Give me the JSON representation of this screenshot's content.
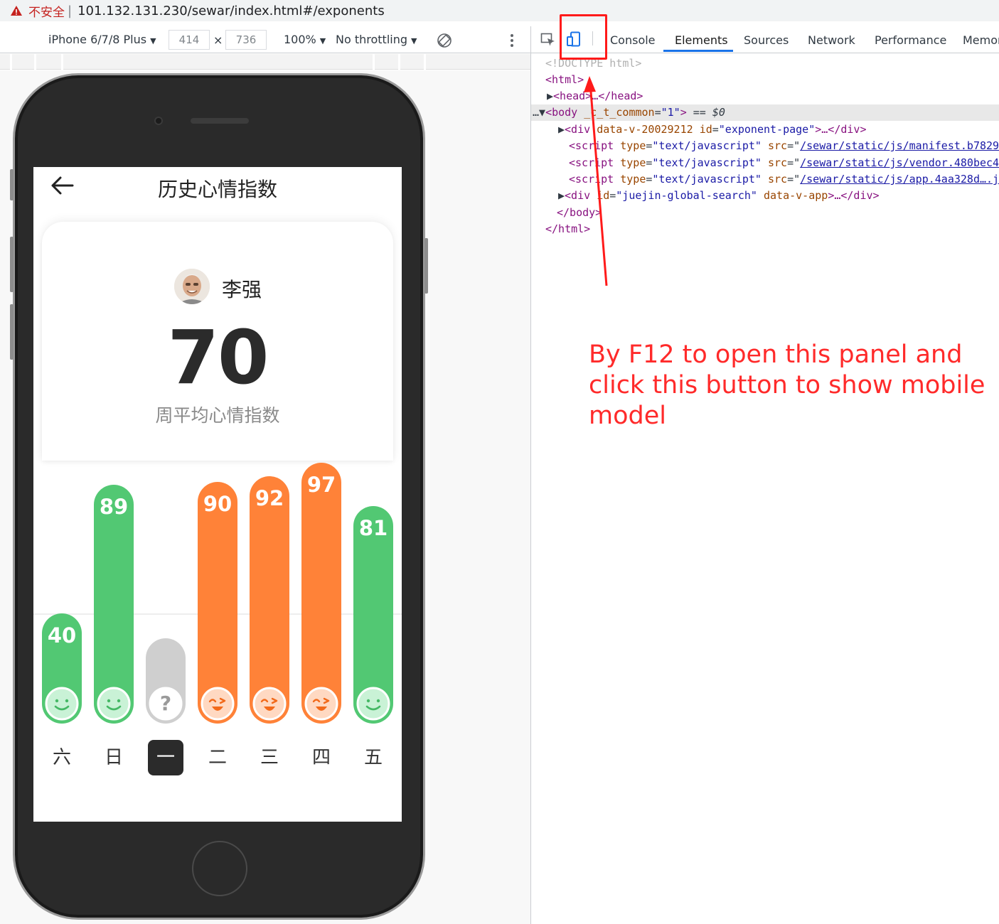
{
  "browser": {
    "insecure_label": "不安全",
    "separator": "|",
    "url": "101.132.131.230/sewar/index.html#/exponents"
  },
  "device_toolbar": {
    "device": "iPhone 6/7/8 Plus",
    "width": "414",
    "times": "×",
    "height": "736",
    "zoom": "100%",
    "throttling": "No throttling"
  },
  "devtools": {
    "tabs": [
      "Console",
      "Elements",
      "Sources",
      "Network",
      "Performance",
      "Memor"
    ],
    "active_tab": "Elements",
    "dom": {
      "doctype": "<!DOCTYPE html>",
      "html_open": "<html>",
      "head": "<head>…</head>",
      "body_tag": "body",
      "body_attr": "_c_t_common",
      "body_val": "\"1\"",
      "body_suffix": "== $0",
      "div1_attr1": "data-v-20029212",
      "div1_attr2": "id",
      "div1_val2": "\"exponent-page\"",
      "script_type_val": "\"text/javascript\"",
      "script1_src": "/sewar/static/js/manifest.b7829",
      "script2_src": "/sewar/static/js/vendor.480bec4",
      "script3_src": "/sewar/static/js/app.4aa328d….j",
      "div2_attr1": "id",
      "div2_val1": "\"juejin-global-search\"",
      "div2_attr2": "data-v-app",
      "body_close": "</body>",
      "html_close": "</html>"
    }
  },
  "annotation": "By F12 to open this panel and click this button to show mobile model",
  "app": {
    "title": "历史心情指数",
    "user_name": "李强",
    "score": "70",
    "score_label": "周平均心情指数",
    "colors": {
      "green": "#52c873",
      "orange": "#ff8238",
      "gray": "#cfcfcf"
    },
    "bars": [
      {
        "day": "六",
        "value": "40",
        "level": 40,
        "mood": "smile",
        "color": "green"
      },
      {
        "day": "日",
        "value": "89",
        "level": 89,
        "mood": "smile",
        "color": "green"
      },
      {
        "day": "一",
        "value": "",
        "level": 0,
        "mood": "unknown",
        "color": "gray"
      },
      {
        "day": "二",
        "value": "90",
        "level": 90,
        "mood": "laugh",
        "color": "orange"
      },
      {
        "day": "三",
        "value": "92",
        "level": 92,
        "mood": "laugh",
        "color": "orange"
      },
      {
        "day": "四",
        "value": "97",
        "level": 97,
        "mood": "laugh",
        "color": "orange"
      },
      {
        "day": "五",
        "value": "81",
        "level": 81,
        "mood": "smile",
        "color": "green"
      }
    ],
    "active_day": "一"
  }
}
